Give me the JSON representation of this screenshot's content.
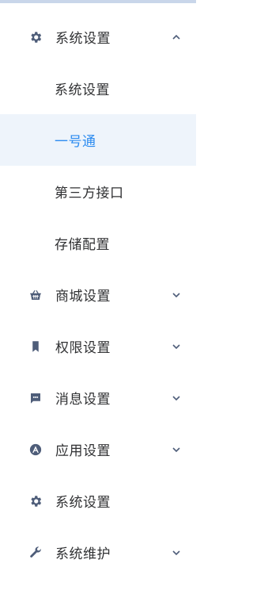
{
  "menu": {
    "system_settings": "系统设置",
    "system_settings_sub": "系统设置",
    "yihaotong": "一号通",
    "third_party": "第三方接口",
    "storage": "存储配置",
    "mall_settings": "商城设置",
    "permission_settings": "权限设置",
    "message_settings": "消息设置",
    "app_settings": "应用设置",
    "system_settings_2": "系统设置",
    "system_maintenance": "系统维护"
  },
  "colors": {
    "active_text": "#2d8cf0",
    "active_bg": "#eef4fb",
    "icon": "#4e5d79"
  }
}
